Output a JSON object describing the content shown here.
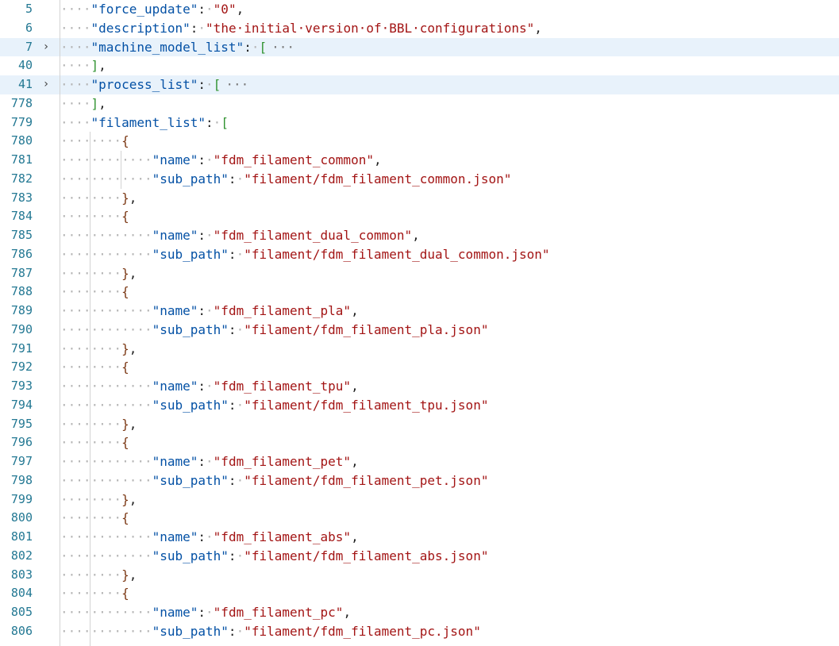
{
  "editor": {
    "lines": [
      {
        "ln": "5",
        "fold": "",
        "indent": "····",
        "tokens": [
          [
            "key",
            "\"force_update\""
          ],
          [
            "punct",
            ":"
          ],
          [
            "ws",
            "·"
          ],
          [
            "str",
            "\"0\""
          ],
          [
            "punct",
            ","
          ]
        ],
        "hl": false
      },
      {
        "ln": "6",
        "fold": "",
        "indent": "····",
        "tokens": [
          [
            "key",
            "\"description\""
          ],
          [
            "punct",
            ":"
          ],
          [
            "ws",
            "·"
          ],
          [
            "str",
            "\"the·initial·version·of·BBL·configurations\""
          ],
          [
            "punct",
            ","
          ]
        ],
        "hl": false
      },
      {
        "ln": "7",
        "fold": "›",
        "indent": "····",
        "tokens": [
          [
            "key",
            "\"machine_model_list\""
          ],
          [
            "punct",
            ":"
          ],
          [
            "ws",
            "·"
          ],
          [
            "b1",
            "["
          ],
          [
            "coll",
            "···"
          ]
        ],
        "hl": true
      },
      {
        "ln": "40",
        "fold": "",
        "indent": "····",
        "tokens": [
          [
            "b1",
            "]"
          ],
          [
            "punct",
            ","
          ]
        ],
        "hl": false
      },
      {
        "ln": "41",
        "fold": "›",
        "indent": "····",
        "tokens": [
          [
            "key",
            "\"process_list\""
          ],
          [
            "punct",
            ":"
          ],
          [
            "ws",
            "·"
          ],
          [
            "b1",
            "["
          ],
          [
            "coll",
            "···"
          ]
        ],
        "hl": true
      },
      {
        "ln": "778",
        "fold": "",
        "indent": "····",
        "tokens": [
          [
            "b1",
            "]"
          ],
          [
            "punct",
            ","
          ]
        ],
        "hl": false
      },
      {
        "ln": "779",
        "fold": "",
        "indent": "····",
        "tokens": [
          [
            "key",
            "\"filament_list\""
          ],
          [
            "punct",
            ":"
          ],
          [
            "ws",
            "·"
          ],
          [
            "b1",
            "["
          ]
        ],
        "hl": false
      },
      {
        "ln": "780",
        "fold": "",
        "indent": "········",
        "tokens": [
          [
            "b2",
            "{"
          ]
        ],
        "hl": false
      },
      {
        "ln": "781",
        "fold": "",
        "indent": "············",
        "tokens": [
          [
            "key",
            "\"name\""
          ],
          [
            "punct",
            ":"
          ],
          [
            "ws",
            "·"
          ],
          [
            "str",
            "\"fdm_filament_common\""
          ],
          [
            "punct",
            ","
          ]
        ],
        "hl": false
      },
      {
        "ln": "782",
        "fold": "",
        "indent": "············",
        "tokens": [
          [
            "key",
            "\"sub_path\""
          ],
          [
            "punct",
            ":"
          ],
          [
            "ws",
            "·"
          ],
          [
            "str",
            "\"filament/fdm_filament_common.json\""
          ]
        ],
        "hl": false
      },
      {
        "ln": "783",
        "fold": "",
        "indent": "········",
        "tokens": [
          [
            "b2",
            "}"
          ],
          [
            "punct",
            ","
          ]
        ],
        "hl": false
      },
      {
        "ln": "784",
        "fold": "",
        "indent": "········",
        "tokens": [
          [
            "b2",
            "{"
          ]
        ],
        "hl": false
      },
      {
        "ln": "785",
        "fold": "",
        "indent": "············",
        "tokens": [
          [
            "key",
            "\"name\""
          ],
          [
            "punct",
            ":"
          ],
          [
            "ws",
            "·"
          ],
          [
            "str",
            "\"fdm_filament_dual_common\""
          ],
          [
            "punct",
            ","
          ]
        ],
        "hl": false
      },
      {
        "ln": "786",
        "fold": "",
        "indent": "············",
        "tokens": [
          [
            "key",
            "\"sub_path\""
          ],
          [
            "punct",
            ":"
          ],
          [
            "ws",
            "·"
          ],
          [
            "str",
            "\"filament/fdm_filament_dual_common.json\""
          ]
        ],
        "hl": false
      },
      {
        "ln": "787",
        "fold": "",
        "indent": "········",
        "tokens": [
          [
            "b2",
            "}"
          ],
          [
            "punct",
            ","
          ]
        ],
        "hl": false
      },
      {
        "ln": "788",
        "fold": "",
        "indent": "········",
        "tokens": [
          [
            "b2",
            "{"
          ]
        ],
        "hl": false
      },
      {
        "ln": "789",
        "fold": "",
        "indent": "············",
        "tokens": [
          [
            "key",
            "\"name\""
          ],
          [
            "punct",
            ":"
          ],
          [
            "ws",
            "·"
          ],
          [
            "str",
            "\"fdm_filament_pla\""
          ],
          [
            "punct",
            ","
          ]
        ],
        "hl": false
      },
      {
        "ln": "790",
        "fold": "",
        "indent": "············",
        "tokens": [
          [
            "key",
            "\"sub_path\""
          ],
          [
            "punct",
            ":"
          ],
          [
            "ws",
            "·"
          ],
          [
            "str",
            "\"filament/fdm_filament_pla.json\""
          ]
        ],
        "hl": false
      },
      {
        "ln": "791",
        "fold": "",
        "indent": "········",
        "tokens": [
          [
            "b2",
            "}"
          ],
          [
            "punct",
            ","
          ]
        ],
        "hl": false
      },
      {
        "ln": "792",
        "fold": "",
        "indent": "········",
        "tokens": [
          [
            "b2",
            "{"
          ]
        ],
        "hl": false
      },
      {
        "ln": "793",
        "fold": "",
        "indent": "············",
        "tokens": [
          [
            "key",
            "\"name\""
          ],
          [
            "punct",
            ":"
          ],
          [
            "ws",
            "·"
          ],
          [
            "str",
            "\"fdm_filament_tpu\""
          ],
          [
            "punct",
            ","
          ]
        ],
        "hl": false
      },
      {
        "ln": "794",
        "fold": "",
        "indent": "············",
        "tokens": [
          [
            "key",
            "\"sub_path\""
          ],
          [
            "punct",
            ":"
          ],
          [
            "ws",
            "·"
          ],
          [
            "str",
            "\"filament/fdm_filament_tpu.json\""
          ]
        ],
        "hl": false
      },
      {
        "ln": "795",
        "fold": "",
        "indent": "········",
        "tokens": [
          [
            "b2",
            "}"
          ],
          [
            "punct",
            ","
          ]
        ],
        "hl": false
      },
      {
        "ln": "796",
        "fold": "",
        "indent": "········",
        "tokens": [
          [
            "b2",
            "{"
          ]
        ],
        "hl": false
      },
      {
        "ln": "797",
        "fold": "",
        "indent": "············",
        "tokens": [
          [
            "key",
            "\"name\""
          ],
          [
            "punct",
            ":"
          ],
          [
            "ws",
            "·"
          ],
          [
            "str",
            "\"fdm_filament_pet\""
          ],
          [
            "punct",
            ","
          ]
        ],
        "hl": false
      },
      {
        "ln": "798",
        "fold": "",
        "indent": "············",
        "tokens": [
          [
            "key",
            "\"sub_path\""
          ],
          [
            "punct",
            ":"
          ],
          [
            "ws",
            "·"
          ],
          [
            "str",
            "\"filament/fdm_filament_pet.json\""
          ]
        ],
        "hl": false
      },
      {
        "ln": "799",
        "fold": "",
        "indent": "········",
        "tokens": [
          [
            "b2",
            "}"
          ],
          [
            "punct",
            ","
          ]
        ],
        "hl": false
      },
      {
        "ln": "800",
        "fold": "",
        "indent": "········",
        "tokens": [
          [
            "b2",
            "{"
          ]
        ],
        "hl": false
      },
      {
        "ln": "801",
        "fold": "",
        "indent": "············",
        "tokens": [
          [
            "key",
            "\"name\""
          ],
          [
            "punct",
            ":"
          ],
          [
            "ws",
            "·"
          ],
          [
            "str",
            "\"fdm_filament_abs\""
          ],
          [
            "punct",
            ","
          ]
        ],
        "hl": false
      },
      {
        "ln": "802",
        "fold": "",
        "indent": "············",
        "tokens": [
          [
            "key",
            "\"sub_path\""
          ],
          [
            "punct",
            ":"
          ],
          [
            "ws",
            "·"
          ],
          [
            "str",
            "\"filament/fdm_filament_abs.json\""
          ]
        ],
        "hl": false
      },
      {
        "ln": "803",
        "fold": "",
        "indent": "········",
        "tokens": [
          [
            "b2",
            "}"
          ],
          [
            "punct",
            ","
          ]
        ],
        "hl": false
      },
      {
        "ln": "804",
        "fold": "",
        "indent": "········",
        "tokens": [
          [
            "b2",
            "{"
          ]
        ],
        "hl": false
      },
      {
        "ln": "805",
        "fold": "",
        "indent": "············",
        "tokens": [
          [
            "key",
            "\"name\""
          ],
          [
            "punct",
            ":"
          ],
          [
            "ws",
            "·"
          ],
          [
            "str",
            "\"fdm_filament_pc\""
          ],
          [
            "punct",
            ","
          ]
        ],
        "hl": false
      },
      {
        "ln": "806",
        "fold": "",
        "indent": "············",
        "tokens": [
          [
            "key",
            "\"sub_path\""
          ],
          [
            "punct",
            ":"
          ],
          [
            "ws",
            "·"
          ],
          [
            "str",
            "\"filament/fdm_filament_pc.json\""
          ]
        ],
        "hl": false
      }
    ]
  },
  "colors": {
    "line_number": "#237893",
    "key": "#0451a5",
    "string": "#a31515",
    "bracket_level_1": "#319331",
    "bracket_level_2": "#7b3814",
    "whitespace_dot": "#b3b3b3",
    "fold_highlight": "#e8f2fb"
  }
}
